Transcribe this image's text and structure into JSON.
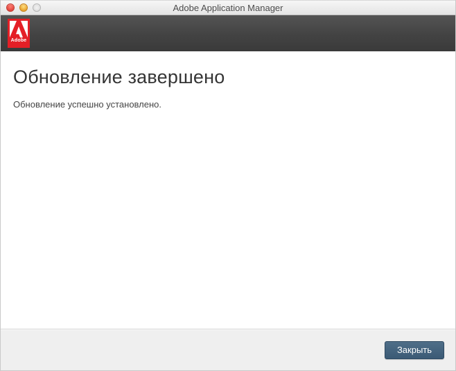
{
  "window": {
    "title": "Adobe Application Manager"
  },
  "header": {
    "brand": "Adobe"
  },
  "content": {
    "heading": "Обновление завершено",
    "subtext": "Обновление успешно установлено."
  },
  "footer": {
    "close_label": "Закрыть"
  }
}
